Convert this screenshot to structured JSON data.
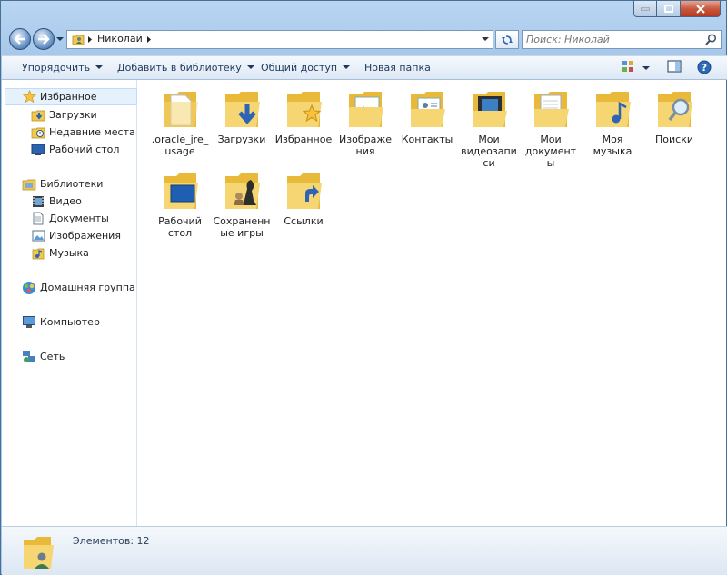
{
  "address": {
    "crumb": "Николай"
  },
  "search": {
    "placeholder": "Поиск: Николай"
  },
  "toolbar": {
    "organize": "Упорядочить",
    "add_to_library": "Добавить в библиотеку",
    "share": "Общий доступ",
    "new_folder": "Новая папка"
  },
  "nav": {
    "favorites": "Избранное",
    "downloads": "Загрузки",
    "recent": "Недавние места",
    "desktop": "Рабочий стол",
    "libraries": "Библиотеки",
    "video": "Видео",
    "documents": "Документы",
    "images": "Изображения",
    "music": "Музыка",
    "homegroup": "Домашняя группа",
    "computer": "Компьютер",
    "network": "Сеть"
  },
  "items": [
    {
      "label": ".oracle_jre_usage",
      "icon": "folder-doc"
    },
    {
      "label": "Загрузки",
      "icon": "folder-download"
    },
    {
      "label": "Избранное",
      "icon": "folder-star"
    },
    {
      "label": "Изображения",
      "icon": "folder-pictures"
    },
    {
      "label": "Контакты",
      "icon": "folder-contacts"
    },
    {
      "label": "Мои видеозаписи",
      "icon": "folder-video"
    },
    {
      "label": "Мои документы",
      "icon": "folder-documents"
    },
    {
      "label": "Моя музыка",
      "icon": "folder-music"
    },
    {
      "label": "Поиски",
      "icon": "folder-search"
    },
    {
      "label": "Рабочий стол",
      "icon": "folder-desktop"
    },
    {
      "label": "Сохраненные игры",
      "icon": "folder-games"
    },
    {
      "label": "Ссылки",
      "icon": "folder-links"
    }
  ],
  "status": {
    "count": "Элементов: 12"
  },
  "colors": {
    "annotation": "#d0141c",
    "folder": "#f2c94c",
    "selection": "#e5f1fb"
  }
}
